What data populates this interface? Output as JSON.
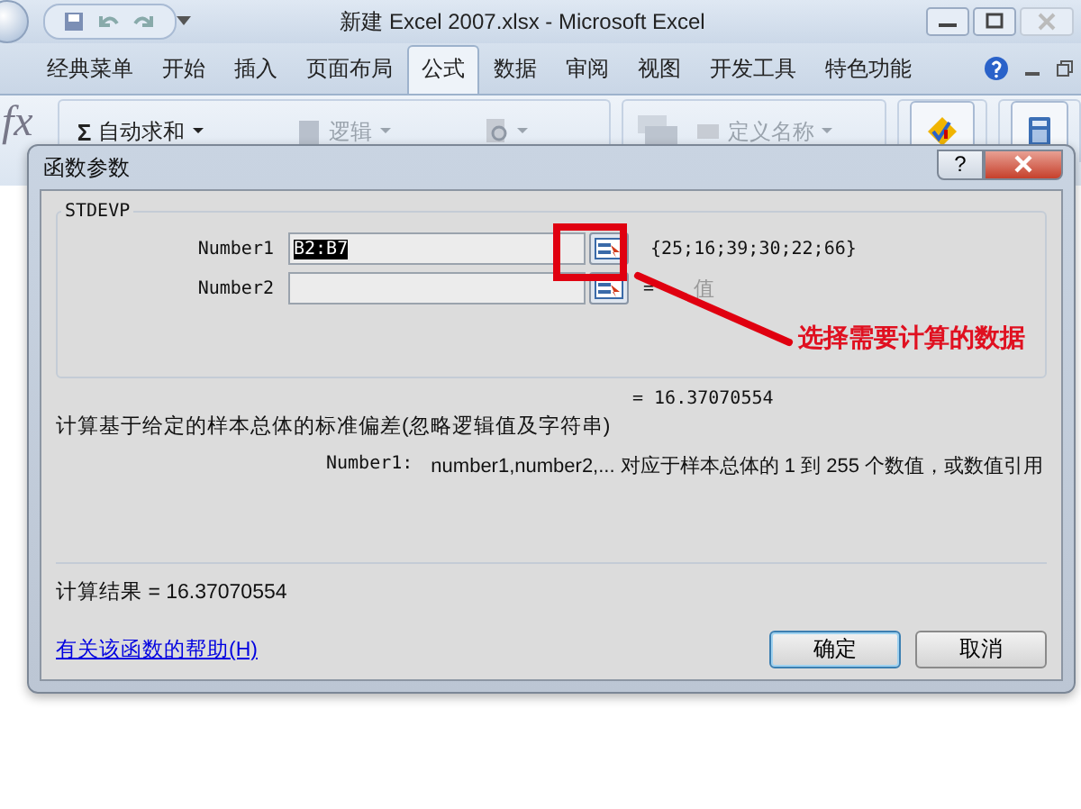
{
  "window": {
    "title": "新建 Excel 2007.xlsx - Microsoft Excel"
  },
  "tabs": [
    {
      "label": "经典菜单",
      "selected": false
    },
    {
      "label": "开始",
      "selected": false
    },
    {
      "label": "插入",
      "selected": false
    },
    {
      "label": "页面布局",
      "selected": false
    },
    {
      "label": "公式",
      "selected": true
    },
    {
      "label": "数据",
      "selected": false
    },
    {
      "label": "审阅",
      "selected": false
    },
    {
      "label": "视图",
      "selected": false
    },
    {
      "label": "开发工具",
      "selected": false
    },
    {
      "label": "特色功能",
      "selected": false
    }
  ],
  "ribbon": {
    "fx": "fx",
    "items": [
      {
        "kind": "sum",
        "glyph": "Σ",
        "label": "自动求和",
        "disabled": false
      },
      {
        "kind": "logic",
        "label": "逻辑",
        "disabled": true
      },
      {
        "kind": "lookup",
        "disabled": true
      },
      {
        "kind": "names",
        "label": "定义名称",
        "disabled": true
      },
      {
        "kind": "audit",
        "disabled": false
      },
      {
        "kind": "calc",
        "disabled": false
      }
    ]
  },
  "dialog": {
    "title": "函数参数",
    "help_glyph": "?",
    "function": "STDEVP",
    "arguments": [
      {
        "label": "Number1",
        "value": "B2:B7",
        "selected": true,
        "result": "{25;16;39;30;22;66}"
      },
      {
        "label": "Number2",
        "equals": "=",
        "placeholder": "值"
      }
    ],
    "formula_value": "= 16.37070554",
    "description": "计算基于给定的样本总体的标准偏差(忽略逻辑值及字符串)",
    "arg_help": {
      "name": "Number1:",
      "text": "number1,number2,... 对应于样本总体的 1 到 255 个数值，或数值引用"
    },
    "result": "计算结果 = 16.37070554",
    "help_link": "有关该函数的帮助(H)",
    "buttons": [
      {
        "label": "确定",
        "default": true
      },
      {
        "label": "取消",
        "default": false
      }
    ]
  },
  "annotation": {
    "label": "选择需要计算的数据"
  }
}
